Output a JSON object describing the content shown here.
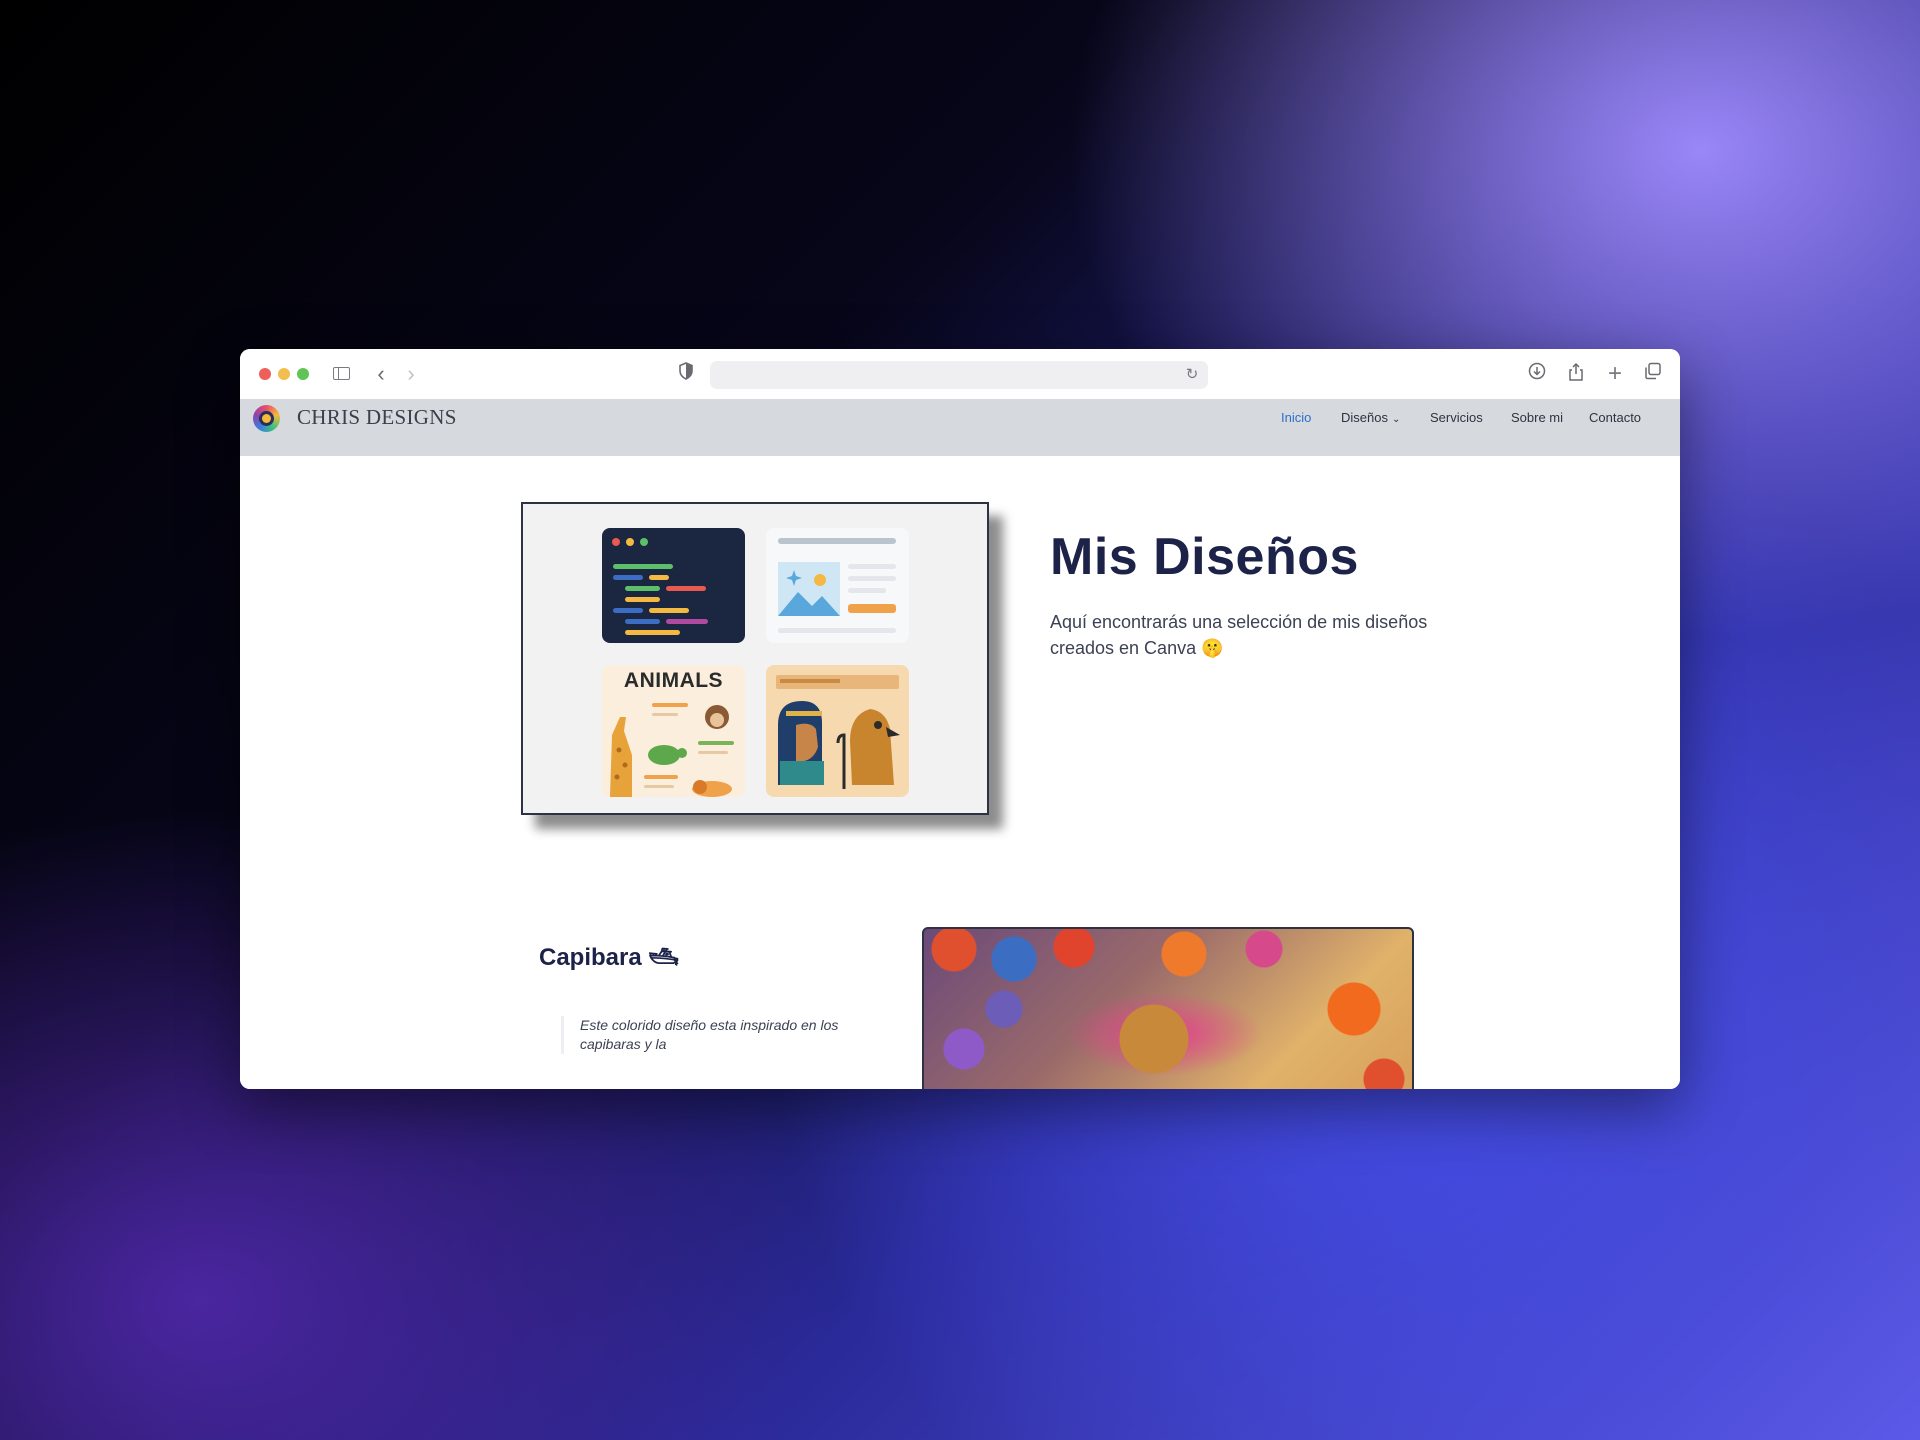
{
  "browser": {
    "address_value": ""
  },
  "site": {
    "brand": "CHRIS DESIGNS",
    "nav": [
      {
        "label": "Inicio",
        "active": true
      },
      {
        "label": "Diseños",
        "has_dropdown": true
      },
      {
        "label": "Servicios"
      },
      {
        "label": "Sobre mi"
      },
      {
        "label": "Contacto"
      }
    ],
    "hero": {
      "title": "Mis Diseños",
      "subtitle": "Aquí encontrarás una selección de mis diseños creados en Canva 🤫",
      "card_tiles": [
        "code-editor",
        "image-layout",
        "animals-poster",
        "egyptian-art"
      ],
      "animals_label": "ANIMALS"
    },
    "section": {
      "title": "Capibara 🛥",
      "description": "Este colorido diseño esta inspirado en los capibaras y la"
    }
  },
  "colors": {
    "accent": "#2d6fc9",
    "navbar_bg": "#d6d9dd",
    "heading": "#1d2348"
  }
}
